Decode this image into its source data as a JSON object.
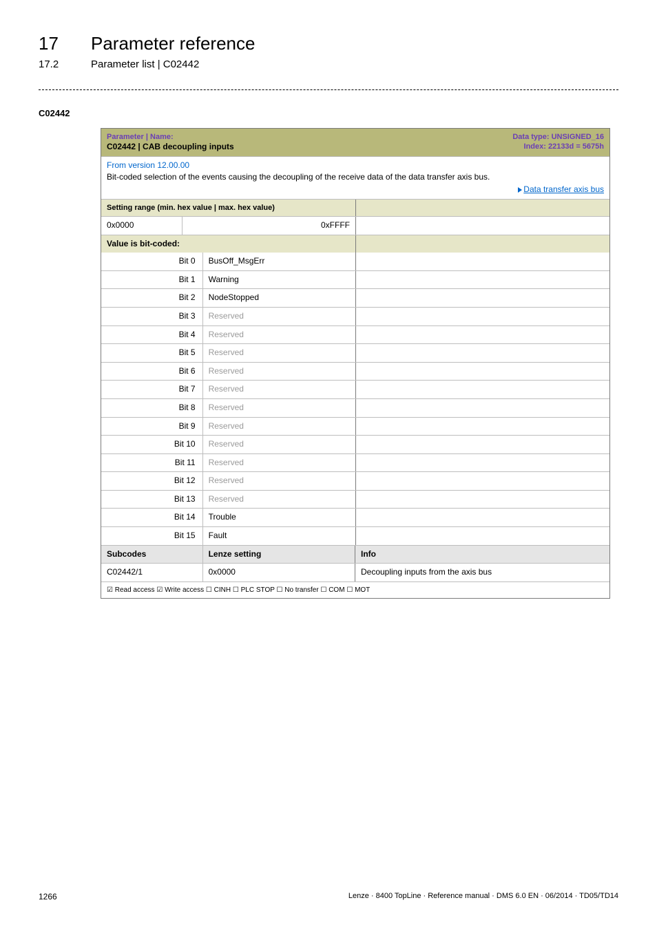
{
  "header": {
    "chapter_num": "17",
    "chapter_title": "Parameter reference",
    "section_num": "17.2",
    "section_title": "Parameter list | C02442"
  },
  "param_code": "C02442",
  "table": {
    "hdr": {
      "left_label": "Parameter | Name:",
      "left_value": "C02442 | CAB decoupling inputs",
      "right_line1": "Data type: UNSIGNED_16",
      "right_line2": "Index: 22133d = 5675h"
    },
    "desc": {
      "version": "From version 12.00.00",
      "text": "Bit-coded selection of the events causing the decoupling of the receive data of the data transfer axis bus.",
      "link": "Data transfer axis bus"
    },
    "setting_range_label": "Setting range (min. hex value | max. hex value)",
    "setting_min": "0x0000",
    "setting_max": "0xFFFF",
    "bitcoded_label": "Value is bit-coded:",
    "bits": [
      {
        "label": "Bit 0",
        "value": "BusOff_MsgErr",
        "muted": false
      },
      {
        "label": "Bit 1",
        "value": "Warning",
        "muted": false
      },
      {
        "label": "Bit 2",
        "value": "NodeStopped",
        "muted": false
      },
      {
        "label": "Bit 3",
        "value": "Reserved",
        "muted": true
      },
      {
        "label": "Bit 4",
        "value": "Reserved",
        "muted": true
      },
      {
        "label": "Bit 5",
        "value": "Reserved",
        "muted": true
      },
      {
        "label": "Bit 6",
        "value": "Reserved",
        "muted": true
      },
      {
        "label": "Bit 7",
        "value": "Reserved",
        "muted": true
      },
      {
        "label": "Bit 8",
        "value": "Reserved",
        "muted": true
      },
      {
        "label": "Bit 9",
        "value": "Reserved",
        "muted": true
      },
      {
        "label": "Bit 10",
        "value": "Reserved",
        "muted": true
      },
      {
        "label": "Bit 11",
        "value": "Reserved",
        "muted": true
      },
      {
        "label": "Bit 12",
        "value": "Reserved",
        "muted": true
      },
      {
        "label": "Bit 13",
        "value": "Reserved",
        "muted": true
      },
      {
        "label": "Bit 14",
        "value": "Trouble",
        "muted": false
      },
      {
        "label": "Bit 15",
        "value": "Fault",
        "muted": false
      }
    ],
    "subhdr": {
      "c1": "Subcodes",
      "c2": "Lenze setting",
      "c3": "Info"
    },
    "subrow": {
      "c1": "C02442/1",
      "c2": "0x0000",
      "c3": "Decoupling inputs from the axis bus"
    },
    "access": "☑ Read access   ☑ Write access   ☐ CINH   ☐ PLC STOP   ☐ No transfer   ☐ COM   ☐ MOT"
  },
  "footer": {
    "page": "1266",
    "ref": "Lenze · 8400 TopLine · Reference manual · DMS 6.0 EN · 06/2014 · TD05/TD14"
  }
}
